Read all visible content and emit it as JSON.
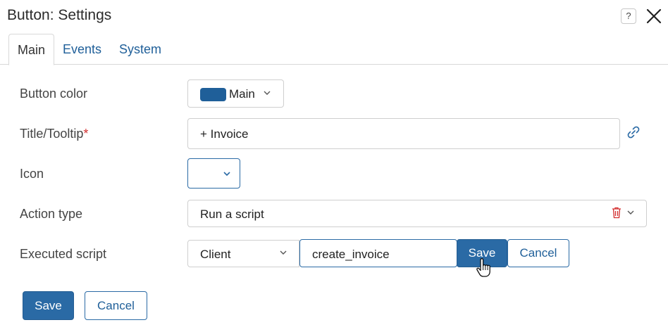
{
  "dialog": {
    "title": "Button: Settings",
    "help_label": "?"
  },
  "tabs": [
    {
      "label": "Main",
      "active": true
    },
    {
      "label": "Events",
      "active": false
    },
    {
      "label": "System",
      "active": false
    }
  ],
  "form": {
    "button_color": {
      "label": "Button color",
      "value": "Main",
      "swatch": "#1f5f99"
    },
    "title_tooltip": {
      "label": "Title/Tooltip",
      "required_mark": "*",
      "value": "+ Invoice"
    },
    "icon": {
      "label": "Icon",
      "value": ""
    },
    "action_type": {
      "label": "Action type",
      "value": "Run a script"
    },
    "executed_script": {
      "label": "Executed script",
      "side": "Client",
      "script_name": "create_invoice",
      "save_label": "Save",
      "cancel_label": "Cancel"
    }
  },
  "footer": {
    "save_label": "Save",
    "cancel_label": "Cancel"
  },
  "colors": {
    "accent": "#2a6aa5",
    "link": "#1f5f99",
    "danger": "#d32f2f"
  }
}
